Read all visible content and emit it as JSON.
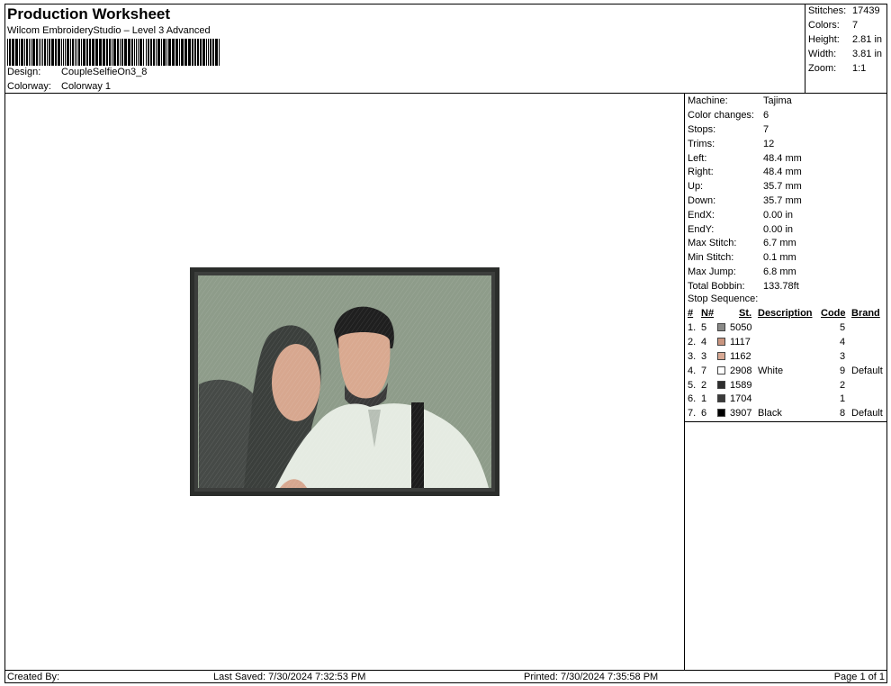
{
  "header": {
    "title": "Production Worksheet",
    "subtitle": "Wilcom EmbroideryStudio – Level 3 Advanced",
    "design_label": "Design:",
    "design_value": "CoupleSelfieOn3_8",
    "colorway_label": "Colorway:",
    "colorway_value": "Colorway 1"
  },
  "stats": [
    {
      "label": "Stitches:",
      "value": "17439"
    },
    {
      "label": "Colors:",
      "value": "7"
    },
    {
      "label": "Height:",
      "value": "2.81 in"
    },
    {
      "label": "Width:",
      "value": "3.81 in"
    },
    {
      "label": "Zoom:",
      "value": "1:1"
    }
  ],
  "machine_info": [
    {
      "label": "Machine:",
      "value": "Tajima"
    },
    {
      "label": "Color changes:",
      "value": "6"
    },
    {
      "label": "Stops:",
      "value": "7"
    },
    {
      "label": "Trims:",
      "value": "12"
    },
    {
      "label": "Left:",
      "value": "48.4 mm"
    },
    {
      "label": "Right:",
      "value": "48.4 mm"
    },
    {
      "label": "Up:",
      "value": "35.7 mm"
    },
    {
      "label": "Down:",
      "value": "35.7 mm"
    },
    {
      "label": "EndX:",
      "value": "0.00 in"
    },
    {
      "label": "EndY:",
      "value": "0.00 in"
    },
    {
      "label": "Max Stitch:",
      "value": "6.7 mm"
    },
    {
      "label": "Min Stitch:",
      "value": "0.1 mm"
    },
    {
      "label": "Max Jump:",
      "value": "6.8 mm"
    },
    {
      "label": "Total Bobbin:",
      "value": "133.78ft"
    }
  ],
  "stop_sequence": {
    "title": "Stop Sequence:",
    "headers": {
      "idx": "#",
      "n": "N#",
      "st": "St.",
      "desc": "Description",
      "code": "Code",
      "brand": "Brand"
    },
    "rows": [
      {
        "idx": "1.",
        "n": "5",
        "color": "#8a8a88",
        "code": "5050",
        "desc": "",
        "code2": "5",
        "brand": ""
      },
      {
        "idx": "2.",
        "n": "4",
        "color": "#c9957f",
        "code": "1117",
        "desc": "",
        "code2": "4",
        "brand": ""
      },
      {
        "idx": "3.",
        "n": "3",
        "color": "#d8a994",
        "code": "1162",
        "desc": "",
        "code2": "3",
        "brand": ""
      },
      {
        "idx": "4.",
        "n": "7",
        "color": "#ffffff",
        "code": "2908",
        "desc": "White",
        "code2": "9",
        "brand": "Default"
      },
      {
        "idx": "5.",
        "n": "2",
        "color": "#2e2e2e",
        "code": "1589",
        "desc": "",
        "code2": "2",
        "brand": ""
      },
      {
        "idx": "6.",
        "n": "1",
        "color": "#3a3a3a",
        "code": "1704",
        "desc": "",
        "code2": "1",
        "brand": ""
      },
      {
        "idx": "7.",
        "n": "6",
        "color": "#000000",
        "code": "3907",
        "desc": "Black",
        "code2": "8",
        "brand": "Default"
      }
    ]
  },
  "footer": {
    "created_by": "Created By:",
    "last_saved": "Last Saved: 7/30/2024 7:32:53 PM",
    "printed": "Printed: 7/30/2024 7:35:58 PM",
    "page": "Page 1 of 1"
  }
}
